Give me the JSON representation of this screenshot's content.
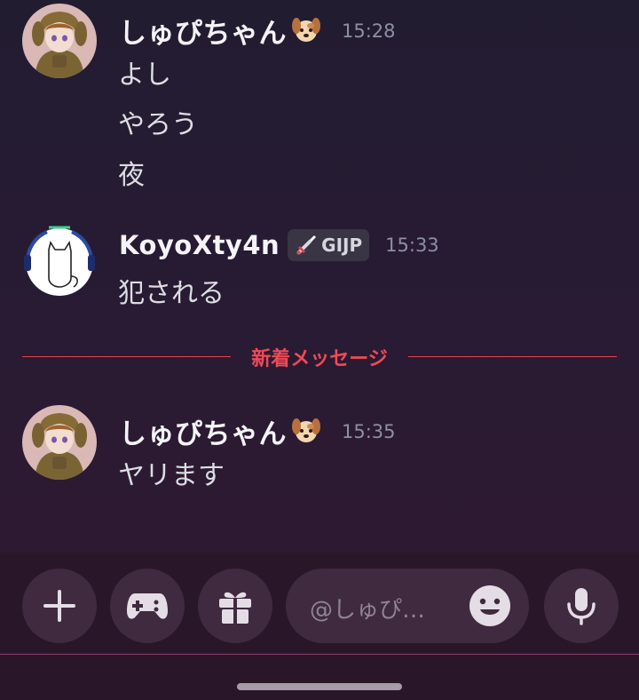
{
  "messages": [
    {
      "author": "しゅぴちゃん",
      "author_emoji": "dog-face-icon",
      "time": "15:28",
      "lines": [
        "よし",
        "やろう",
        "夜"
      ]
    },
    {
      "author": "KoyoXty4n",
      "tag": "GIJP",
      "tag_icon": "sword-icon",
      "time": "15:33",
      "lines": [
        "犯される"
      ]
    },
    {
      "author": "しゅぴちゃん",
      "author_emoji": "dog-face-icon",
      "time": "15:35",
      "lines": [
        "ヤリます"
      ]
    }
  ],
  "divider": {
    "label": "新着メッセージ"
  },
  "composer": {
    "placeholder": "@しゅぴ…",
    "buttons": [
      "plus-icon",
      "gamepad-icon",
      "gift-icon",
      "emoji-icon",
      "microphone-icon"
    ]
  },
  "colors": {
    "background": "#241b31",
    "new_message_red": "#ef4a57",
    "composer_bg": "#2a1629",
    "button_bg": "#3f2a3f"
  }
}
